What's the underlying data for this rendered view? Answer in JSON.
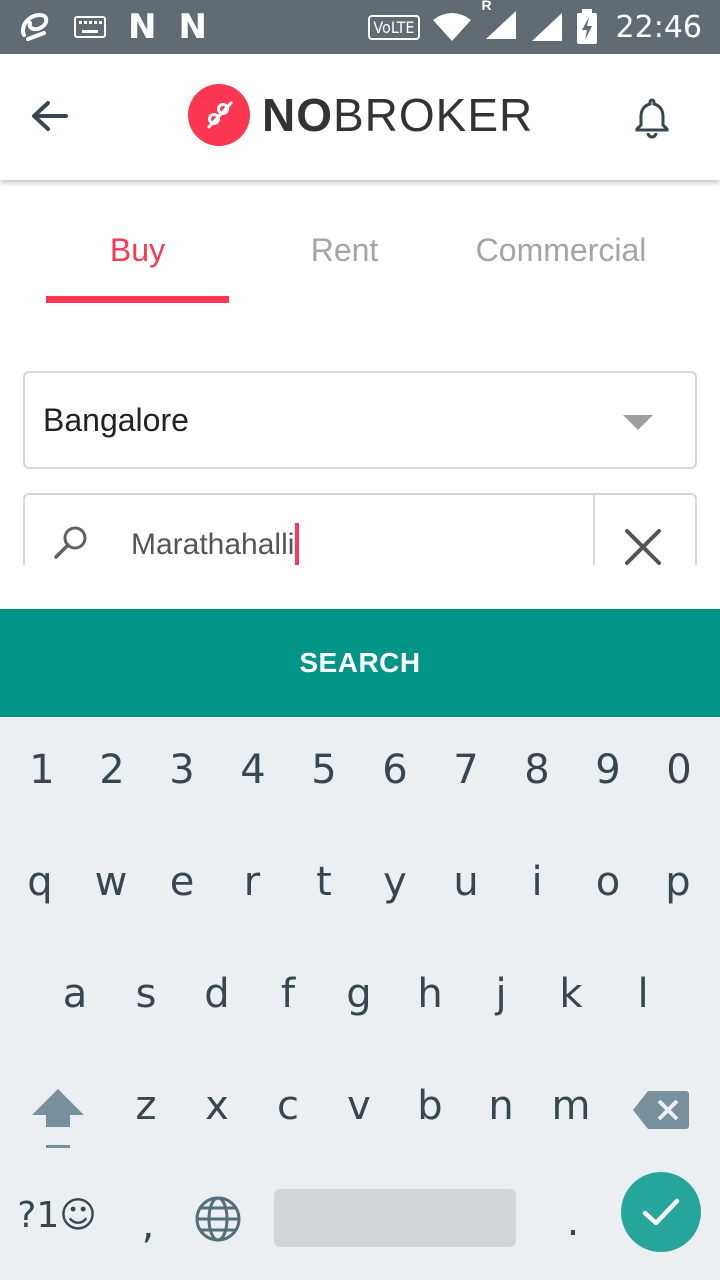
{
  "status_bar": {
    "time": "22:46",
    "volte": "VoLTE",
    "notification_letters": [
      "N",
      "N"
    ],
    "roaming": "R"
  },
  "app_bar": {
    "logo_bold": "NO",
    "logo_light": "BROKER",
    "brand_color": "#fd3752"
  },
  "tabs": [
    {
      "label": "Buy",
      "active": true
    },
    {
      "label": "Rent",
      "active": false
    },
    {
      "label": "Commercial",
      "active": false
    }
  ],
  "city_select": {
    "value": "Bangalore"
  },
  "search": {
    "value": "Marathahalli"
  },
  "search_button": {
    "label": "SEARCH",
    "color": "#009587"
  },
  "keyboard": {
    "row_numbers": [
      "1",
      "2",
      "3",
      "4",
      "5",
      "6",
      "7",
      "8",
      "9",
      "0"
    ],
    "row_1": [
      "q",
      "w",
      "e",
      "r",
      "t",
      "y",
      "u",
      "i",
      "o",
      "p"
    ],
    "row_2": [
      "a",
      "s",
      "d",
      "f",
      "g",
      "h",
      "j",
      "k",
      "l"
    ],
    "row_3": [
      "z",
      "x",
      "c",
      "v",
      "b",
      "n",
      "m"
    ],
    "symbols_key": "?1☺",
    "comma": ",",
    "period": "."
  }
}
